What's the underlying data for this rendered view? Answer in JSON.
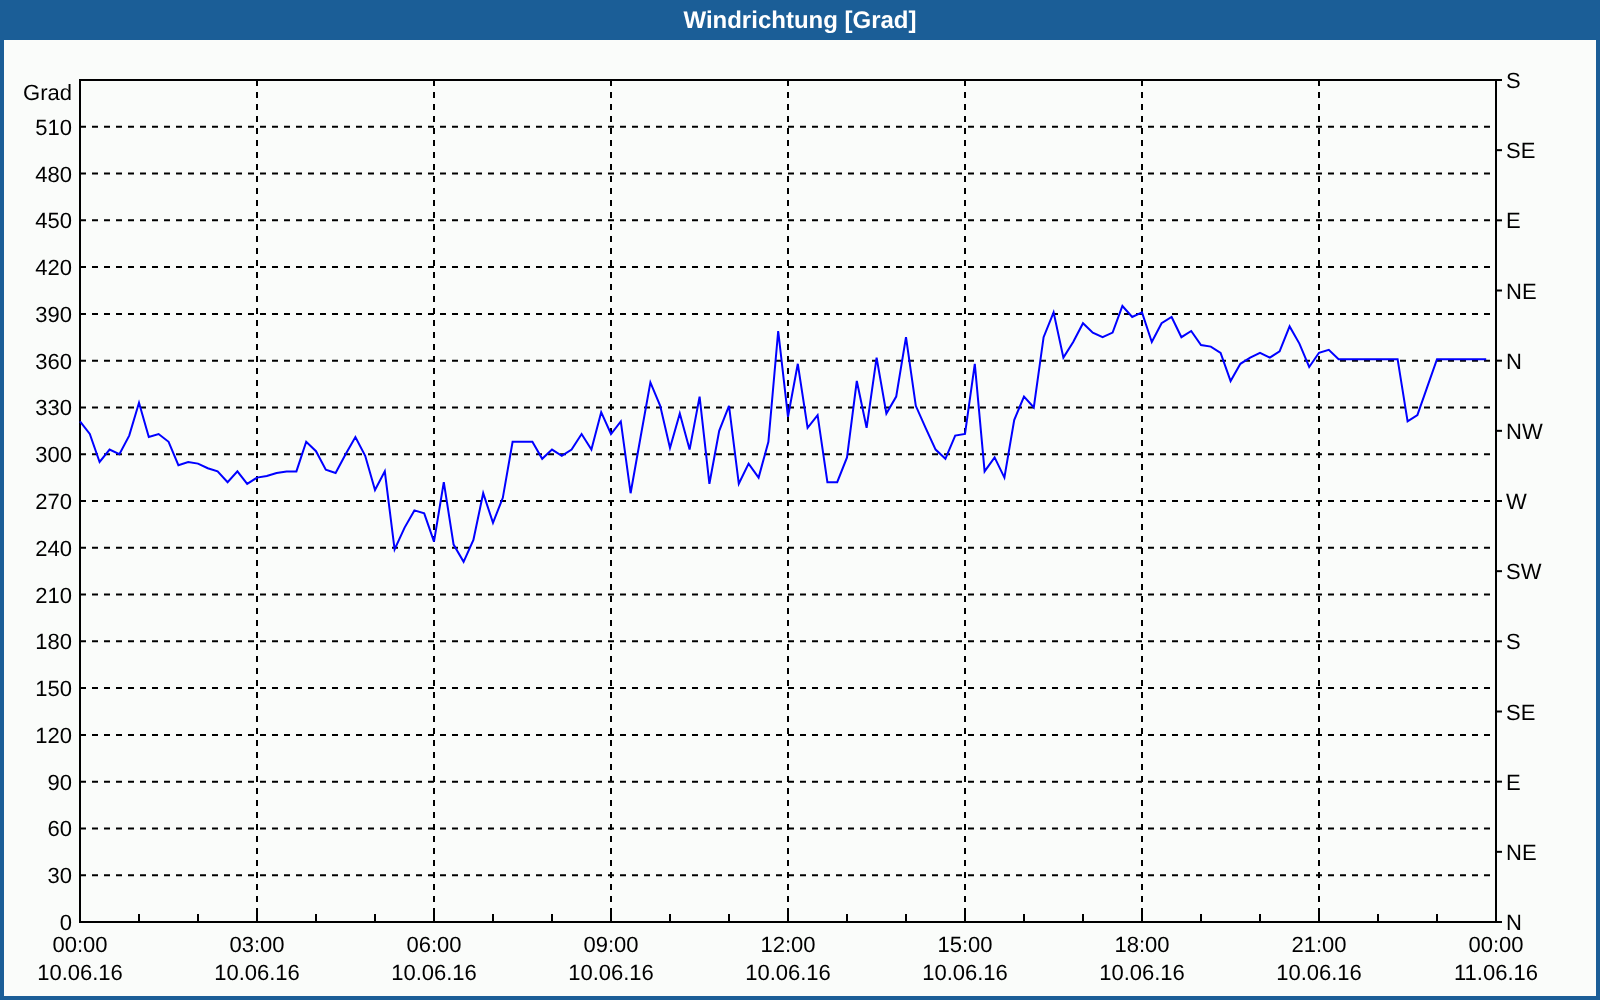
{
  "window": {
    "title": "Windrichtung [Grad]"
  },
  "chart": {
    "chart_data": {
      "type": "line",
      "ylabel": "Grad",
      "grid": true,
      "xlim": [
        0,
        1440
      ],
      "ylim": [
        0,
        540
      ],
      "x": [
        0,
        10,
        20,
        30,
        40,
        50,
        60,
        70,
        80,
        90,
        100,
        110,
        120,
        130,
        140,
        150,
        160,
        170,
        180,
        190,
        200,
        210,
        220,
        230,
        240,
        250,
        260,
        270,
        280,
        290,
        300,
        310,
        320,
        330,
        340,
        350,
        360,
        370,
        380,
        390,
        400,
        410,
        420,
        430,
        440,
        450,
        460,
        470,
        480,
        490,
        500,
        510,
        520,
        530,
        540,
        550,
        560,
        570,
        580,
        590,
        600,
        610,
        620,
        630,
        640,
        650,
        660,
        670,
        680,
        690,
        700,
        710,
        720,
        730,
        740,
        750,
        760,
        770,
        780,
        790,
        800,
        810,
        820,
        830,
        840,
        850,
        860,
        870,
        880,
        890,
        900,
        910,
        920,
        930,
        940,
        950,
        960,
        970,
        980,
        990,
        1000,
        1010,
        1020,
        1030,
        1040,
        1050,
        1060,
        1070,
        1080,
        1090,
        1100,
        1110,
        1120,
        1130,
        1140,
        1150,
        1160,
        1170,
        1180,
        1190,
        1200,
        1210,
        1220,
        1230,
        1240,
        1250,
        1260,
        1270,
        1280,
        1290,
        1300,
        1310,
        1320,
        1330,
        1340,
        1350,
        1360,
        1370,
        1380,
        1390,
        1400,
        1410,
        1420,
        1430
      ],
      "series": [
        {
          "color": "#0000ff",
          "values": [
            321,
            313,
            295,
            303,
            300,
            312,
            333,
            311,
            313,
            308,
            293,
            295,
            294,
            291,
            289,
            282,
            289,
            281,
            285,
            286,
            288,
            289,
            289,
            308,
            302,
            290,
            288,
            300,
            311,
            299,
            277,
            289,
            239,
            253,
            264,
            262,
            244,
            282,
            242,
            231,
            245,
            275,
            256,
            272,
            308,
            308,
            308,
            297,
            303,
            299,
            303,
            313,
            303,
            327,
            313,
            321,
            275,
            311,
            346,
            331,
            304,
            326,
            303,
            337,
            281,
            315,
            331,
            281,
            294,
            285,
            308,
            379,
            324,
            358,
            317,
            325,
            282,
            282,
            298,
            347,
            317,
            362,
            326,
            337,
            375,
            331,
            317,
            303,
            297,
            312,
            313,
            358,
            289,
            298,
            285,
            322,
            337,
            330,
            375,
            391,
            362,
            372,
            384,
            378,
            375,
            378,
            395,
            388,
            391,
            372,
            384,
            388,
            375,
            379,
            370,
            369,
            365,
            347,
            358,
            362,
            365,
            362,
            366,
            382,
            371,
            356,
            365,
            367,
            361,
            361,
            361,
            361,
            361,
            361,
            361,
            321,
            325,
            343,
            361,
            361,
            361,
            361,
            361,
            361
          ]
        }
      ],
      "xticks": [
        {
          "value": 0,
          "label": "00:00"
        },
        {
          "value": 180,
          "label": "03:00"
        },
        {
          "value": 360,
          "label": "06:00"
        },
        {
          "value": 540,
          "label": "09:00"
        },
        {
          "value": 720,
          "label": "12:00"
        },
        {
          "value": 900,
          "label": "15:00"
        },
        {
          "value": 1080,
          "label": "18:00"
        },
        {
          "value": 1260,
          "label": "21:00"
        }
      ],
      "yticks": [
        0,
        30,
        60,
        90,
        120,
        150,
        180,
        210,
        240,
        270,
        300,
        330,
        360,
        390,
        420,
        450,
        480,
        510
      ]
    },
    "x_end_time": "00:00",
    "x_dates": [
      "10.06.16",
      "10.06.16",
      "10.06.16",
      "10.06.16",
      "10.06.16",
      "10.06.16",
      "10.06.16",
      "10.06.16",
      "11.06.16"
    ],
    "compass_labels": [
      "S",
      "SE",
      "E",
      "NE",
      "N",
      "NW",
      "W",
      "SW",
      "S",
      "SE",
      "E",
      "NE",
      "N"
    ]
  }
}
